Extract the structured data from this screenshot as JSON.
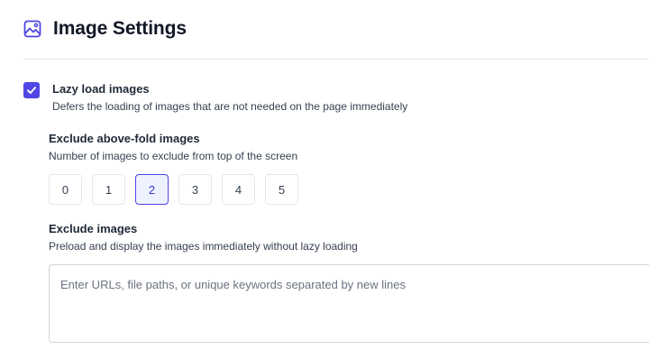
{
  "header": {
    "title": "Image Settings",
    "icon": "image-icon",
    "icon_color": "#4f46e5"
  },
  "lazy_load": {
    "label": "Lazy load images",
    "description": "Defers the loading of images that are not needed on the page immediately",
    "checked": true
  },
  "exclude_above_fold": {
    "label": "Exclude above-fold images",
    "description": "Number of images to exclude from top of the screen",
    "options": [
      "0",
      "1",
      "2",
      "3",
      "4",
      "5"
    ],
    "selected": "2"
  },
  "exclude_images": {
    "label": "Exclude images",
    "description": "Preload and display the images immediately without lazy loading",
    "value": "",
    "placeholder": "Enter URLs, file paths, or unique keywords separated by new lines"
  },
  "colors": {
    "accent": "#4f46e5",
    "selected_bg": "#eef2ff",
    "border": "#e5e7eb"
  }
}
